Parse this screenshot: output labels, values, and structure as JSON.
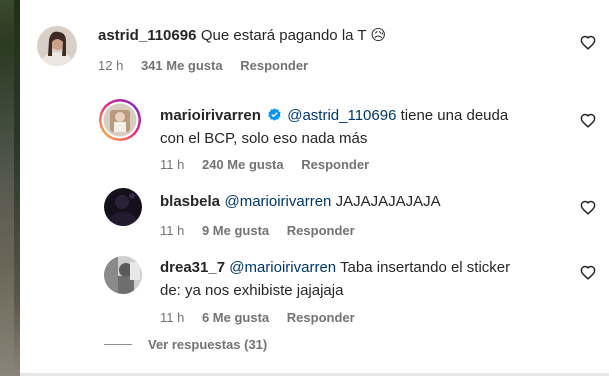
{
  "comments": [
    {
      "username": "astrid_110696",
      "text": "Que estará pagando la T 😥",
      "time": "12 h",
      "likes": "341 Me gusta",
      "reply": "Responder"
    },
    {
      "username": "marioirivarren",
      "verified": true,
      "mention": "@astrid_110696",
      "text_line1": " tiene una deuda",
      "text_line2": "con el BCP, solo eso nada más",
      "time": "11 h",
      "likes": "240 Me gusta",
      "reply": "Responder"
    },
    {
      "username": "blasbela",
      "mention": "@marioirivarren",
      "text": " JAJAJAJAJAJA",
      "time": "11 h",
      "likes": "9 Me gusta",
      "reply": "Responder"
    },
    {
      "username": "drea31_7",
      "mention": "@marioirivarren",
      "text_line1": " Taba insertando el sticker",
      "text_line2": "de: ya nos exhibiste jajajaja",
      "time": "11 h",
      "likes": "6 Me gusta",
      "reply": "Responder"
    }
  ],
  "view_replies": "Ver respuestas (31)",
  "colors": {
    "mention": "#00376b",
    "meta": "#737373",
    "verified": "#0095f6"
  }
}
